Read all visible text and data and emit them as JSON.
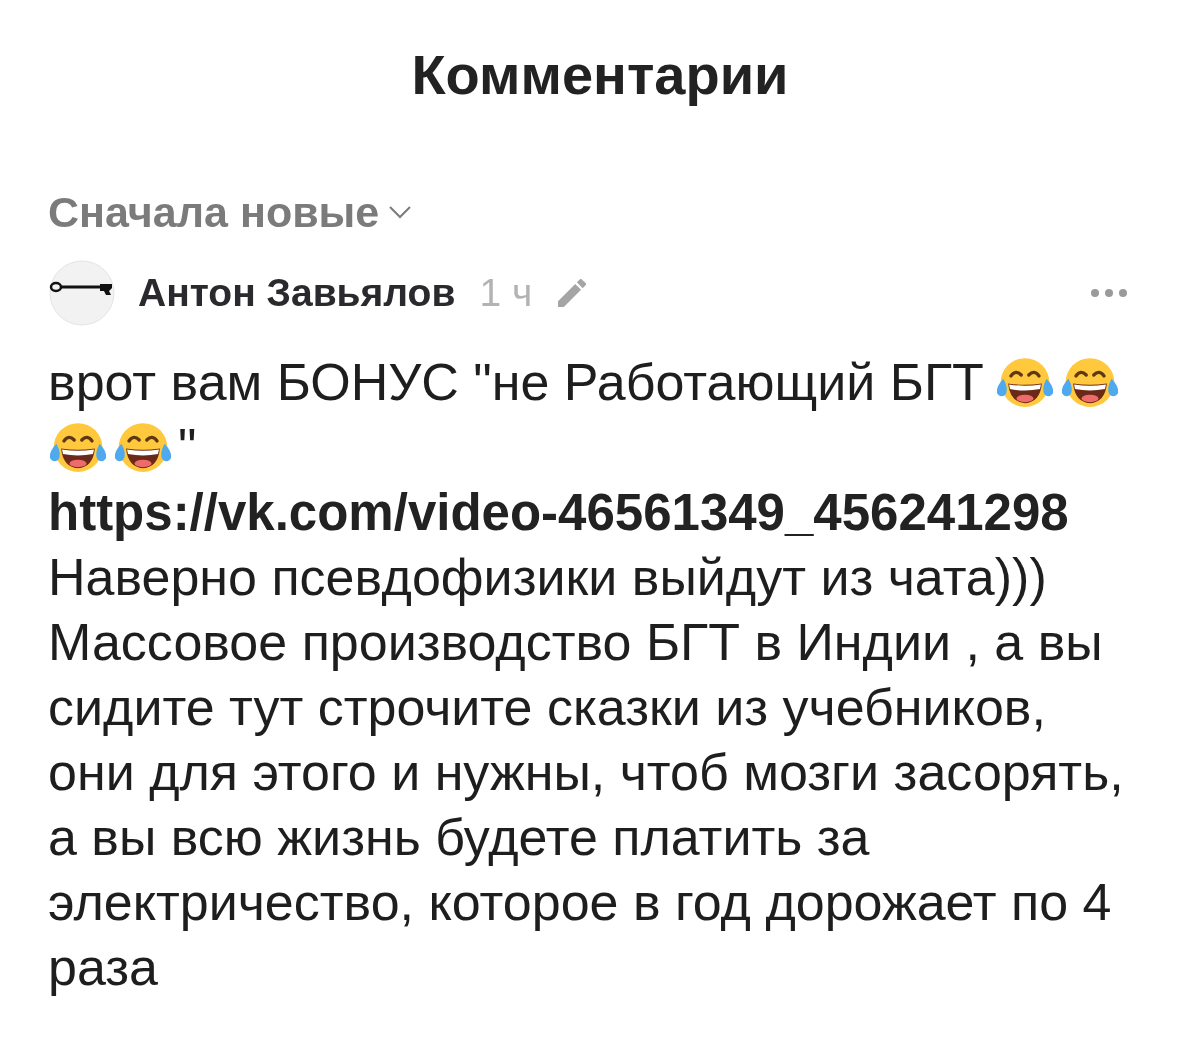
{
  "header": {
    "title": "Комментарии"
  },
  "sort": {
    "label": "Сначала новые"
  },
  "comments": [
    {
      "author": "Антон Завьялов",
      "time": "1 ч",
      "edited": true,
      "body": [
        {
          "kind": "inline",
          "parts": [
            {
              "kind": "text",
              "text": "врот вам БОНУС \"не Работающий БГТ"
            },
            {
              "kind": "emoji"
            },
            {
              "kind": "emoji"
            },
            {
              "kind": "emoji"
            },
            {
              "kind": "emoji"
            },
            {
              "kind": "text",
              "text": "\""
            }
          ]
        },
        {
          "kind": "link",
          "text": "https://vk.com/video-46561349_456241298"
        },
        {
          "kind": "text",
          "text": "Наверно псевдофизики выйдут из чата)))"
        },
        {
          "kind": "text",
          "text": "Массовое производство БГТ в Индии , а вы сидите тут строчите сказки из учебников, они для этого и нужны, чтоб мозги засорять, а вы всю жизнь будете платить за электричество, которое в год дорожает по 4 раза"
        }
      ]
    }
  ]
}
